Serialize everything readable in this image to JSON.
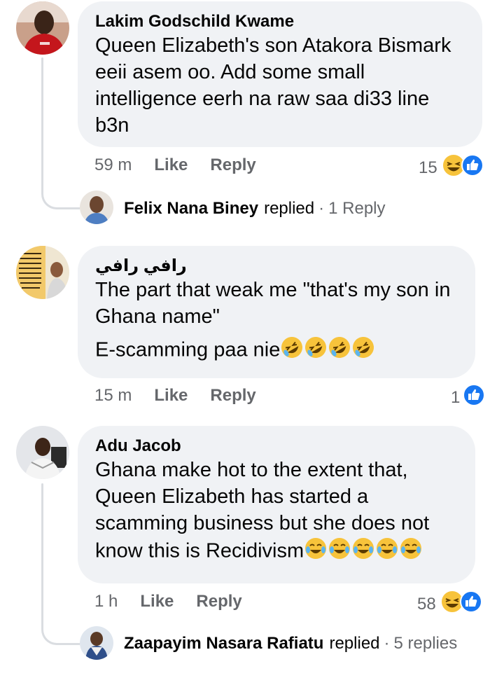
{
  "comments": [
    {
      "author": "Lakim Godschild Kwame",
      "text": "Queen Elizabeth's son Atakora Bismark eeii asem oo. Add some small intelligence eerh na raw saa di33 line b3n",
      "time": "59 m",
      "like_label": "Like",
      "reply_label": "Reply",
      "reaction_count": "15",
      "reactions": [
        "haha-icon",
        "like-icon"
      ],
      "replies": {
        "name": "Felix Nana Biney",
        "verb": "replied",
        "sep": "·",
        "count": "1 Reply"
      }
    },
    {
      "author": "رافي رافي",
      "text_line1": "The part that weak me \"that's my son in Ghana name\"",
      "text_line2": "E-scamming paa nie",
      "time": "15 m",
      "like_label": "Like",
      "reply_label": "Reply",
      "reaction_count": "1",
      "reactions": [
        "like-icon"
      ],
      "trailing_emoji": [
        "rofl-emoji",
        "rofl-emoji",
        "rofl-emoji",
        "rofl-emoji"
      ]
    },
    {
      "author": "Adu Jacob",
      "text": "Ghana make hot to the extent that, Queen Elizabeth has started a scamming business but she does not know this is Recidivism",
      "time": "1 h",
      "like_label": "Like",
      "reply_label": "Reply",
      "reaction_count": "58",
      "reactions": [
        "haha-icon",
        "like-icon"
      ],
      "trailing_emoji": [
        "joy-emoji",
        "joy-emoji",
        "joy-emoji",
        "joy-emoji",
        "joy-emoji"
      ],
      "replies": {
        "name": "Zaapayim Nasara Rafiatu",
        "verb": "replied",
        "sep": "·",
        "count": "5 replies"
      }
    }
  ],
  "colors": {
    "bubble": "#f0f2f5",
    "meta": "#65676b",
    "like_blue": "#1877f2",
    "emoji_yellow": "#f7c33b"
  }
}
